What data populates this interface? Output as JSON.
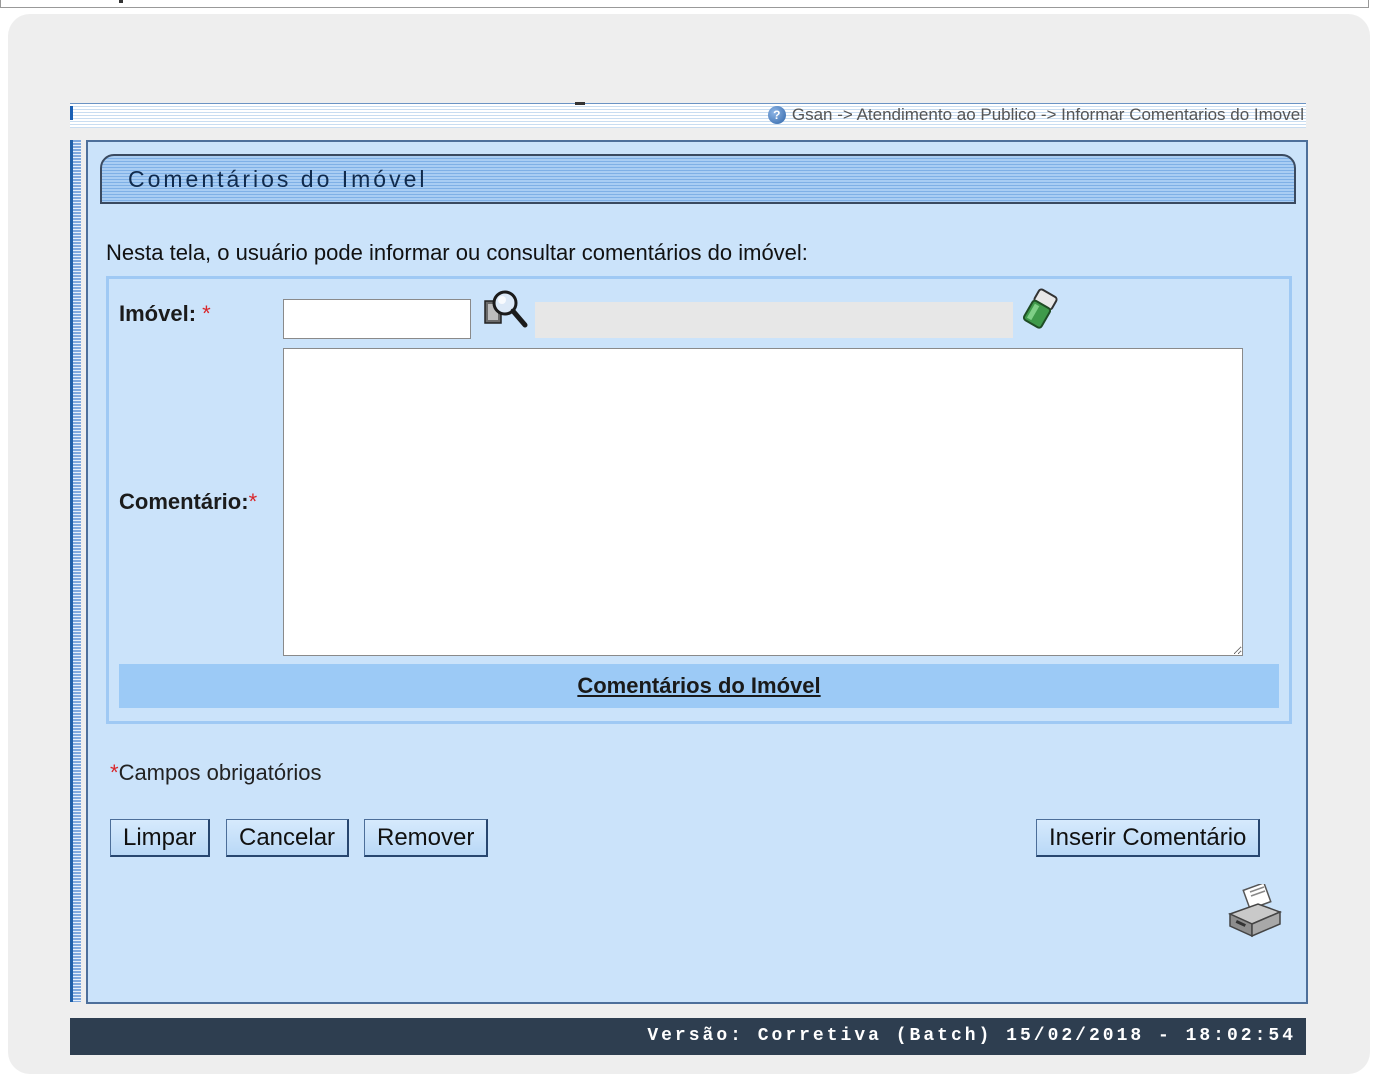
{
  "breadcrumb": {
    "text": "Gsan -> Atendimento ao Publico -> Informar Comentarios do Imovel",
    "help_icon": "question-circle-icon"
  },
  "panel": {
    "title": "Comentários do Imóvel",
    "intro": "Nesta tela, o usuário pode informar ou consultar comentários do imóvel:"
  },
  "form": {
    "imovel_label": "Imóvel:",
    "imovel_required": "*",
    "imovel_value": "",
    "imovel_description": "",
    "comentario_label": "Comentário:",
    "comentario_required": "*",
    "comentario_value": "",
    "comments_link": "Comentários do Imóvel"
  },
  "required_note": {
    "star": "*",
    "text": "Campos obrigatórios"
  },
  "buttons": {
    "limpar": "Limpar",
    "cancelar": "Cancelar",
    "remover": "Remover",
    "inserir": "Inserir Comentário"
  },
  "icons": {
    "search": "magnifier-search-icon",
    "eraser": "eraser-icon",
    "printer": "printer-icon"
  },
  "footer": {
    "version": "Versão: Corretiva (Batch) 15/02/2018 - 18:02:54"
  },
  "colors": {
    "panel_bg": "#cbe3fa",
    "header_blue": "#7fb0e6",
    "link_bar": "#9ccaf6",
    "footer_bg": "#2e3e50",
    "required_red": "#d9262a"
  }
}
